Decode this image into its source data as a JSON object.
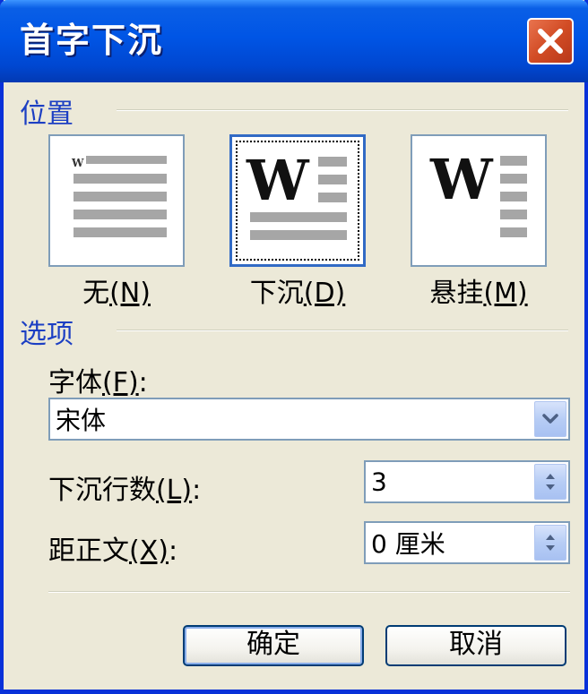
{
  "dialog": {
    "title": "首字下沉"
  },
  "position_group": {
    "title": "位置",
    "options": [
      {
        "label": "无",
        "accel": "(N)",
        "selected": false,
        "icon": "dropcap-none-icon"
      },
      {
        "label": "下沉",
        "accel": "(D)",
        "selected": true,
        "icon": "dropcap-dropped-icon"
      },
      {
        "label": "悬挂",
        "accel": "(M)",
        "selected": false,
        "icon": "dropcap-margin-icon"
      }
    ]
  },
  "options_group": {
    "title": "选项",
    "font": {
      "label": "字体",
      "accel": "(F)",
      "colon": ":",
      "value": "宋体"
    },
    "lines_to_drop": {
      "label": "下沉行数",
      "accel": "(L)",
      "colon": ":",
      "value": "3"
    },
    "distance_from_text": {
      "label": "距正文",
      "accel": "(X)",
      "colon": ":",
      "value": "0 厘米"
    }
  },
  "buttons": {
    "ok": "确定",
    "cancel": "取消"
  },
  "colors": {
    "title_bar": "#0055e5",
    "group_title": "#1c3fc3",
    "close_button": "#d24c25",
    "face": "#ece9d8"
  }
}
